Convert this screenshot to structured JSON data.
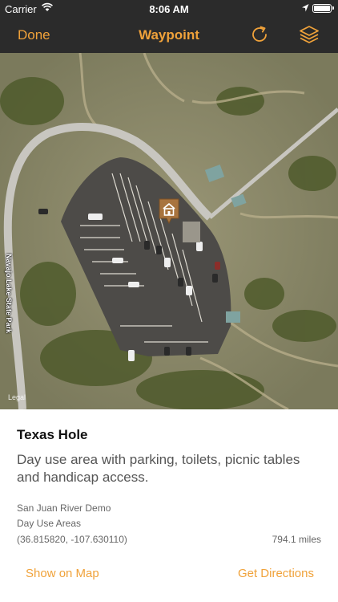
{
  "status_bar": {
    "carrier": "Carrier",
    "time": "8:06 AM",
    "icons": [
      "wifi-icon",
      "location-arrow-icon",
      "battery-icon"
    ]
  },
  "nav_bar": {
    "done_label": "Done",
    "title": "Waypoint",
    "icons": [
      "refresh-icon",
      "layers-icon"
    ],
    "accent_color": "#f0a23a",
    "background_color": "#2b2b2b"
  },
  "map": {
    "road_label": "Navajo Lake State Park",
    "legal_label": "Legal",
    "marker_icon": "cabin-icon"
  },
  "waypoint": {
    "name": "Texas Hole",
    "description": "Day use area with parking, toilets, picnic tables and handicap access.",
    "collection": "San Juan River Demo",
    "category": "Day Use Areas",
    "coordinates": "(36.815820, -107.630110)",
    "distance": "794.1 miles"
  },
  "actions": {
    "show_on_map": "Show on Map",
    "get_directions": "Get Directions"
  }
}
